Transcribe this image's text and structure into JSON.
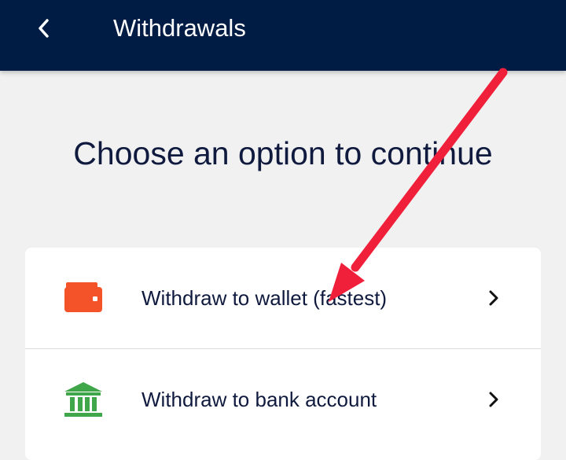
{
  "header": {
    "title": "Withdrawals",
    "back_icon": "chevron-left-icon",
    "background": "#001b44"
  },
  "main": {
    "heading": "Choose an option to continue",
    "options": [
      {
        "label": "Withdraw to wallet (fastest)",
        "icon": "wallet-icon",
        "icon_color": "#f4532a",
        "trailing_icon": "chevron-right-icon"
      },
      {
        "label": "Withdraw to bank account",
        "icon": "bank-icon",
        "icon_color": "#3fa64a",
        "trailing_icon": "chevron-right-icon"
      }
    ]
  },
  "annotation": {
    "icon": "red-arrow-annotation",
    "color": "#f0203a"
  }
}
